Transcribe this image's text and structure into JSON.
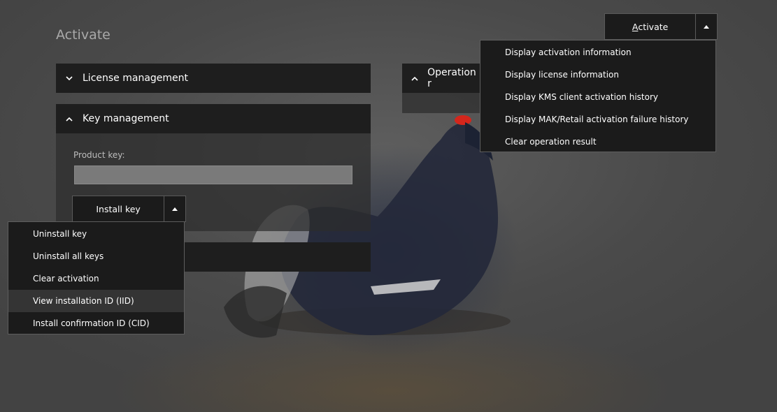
{
  "page": {
    "title": "Activate"
  },
  "activate_button": {
    "label_prefix": "A",
    "label_rest": "ctivate"
  },
  "activate_menu": {
    "items": [
      "Display activation information",
      "Display license information",
      "Display KMS client activation history",
      "Display MAK/Retail activation failure history",
      "Clear operation result"
    ]
  },
  "panels": {
    "license_management": {
      "title": "License management",
      "expanded": false
    },
    "key_management": {
      "title": "Key management",
      "expanded": true
    },
    "operation_result": {
      "title": "Operation r"
    }
  },
  "key_management": {
    "product_key_label": "Product key:",
    "product_key_value": "",
    "install_button": {
      "label": "Install key"
    },
    "menu": {
      "items": [
        "Uninstall key",
        "Uninstall all keys",
        "Clear activation",
        "View installation ID (IID)",
        "Install confirmation ID (CID)"
      ],
      "highlighted_index": 3
    }
  },
  "colors": {
    "panel_header": "#1e1e1e",
    "menu_bg": "#1b1b1b",
    "accent_red": "#d4261c"
  },
  "icons": {
    "collapsed": "chevron-down-icon",
    "expanded": "chevron-up-icon",
    "dropdown": "caret-up-icon"
  }
}
